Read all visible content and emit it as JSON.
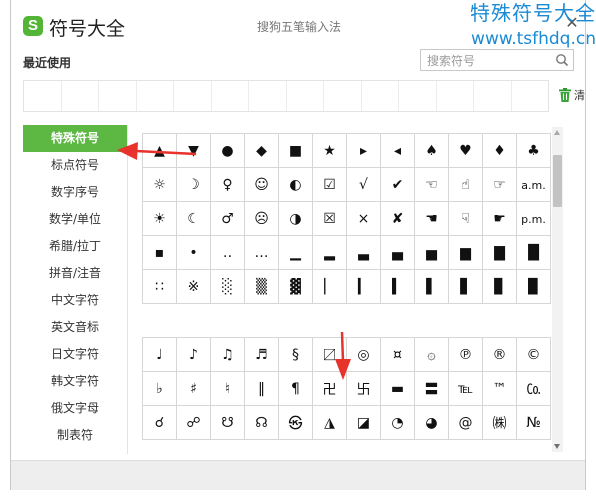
{
  "watermark": {
    "line1": "特殊符号大全",
    "line2": "www.tsfhdq.cn"
  },
  "window": {
    "app_title": "符号大全",
    "ime_name": "搜狗五笔输入法",
    "close_glyph": "✕"
  },
  "recent": {
    "label": "最近使用",
    "slots": 14
  },
  "search": {
    "placeholder": "搜索符号",
    "icon": "search-icon"
  },
  "trash": {
    "icon": "trash-icon",
    "label": "清"
  },
  "sidebar": {
    "active_index": 0,
    "items": [
      {
        "label": "特殊符号"
      },
      {
        "label": "标点符号"
      },
      {
        "label": "数字序号"
      },
      {
        "label": "数学/单位"
      },
      {
        "label": "希腊/拉丁"
      },
      {
        "label": "拼音/注音"
      },
      {
        "label": "中文字符"
      },
      {
        "label": "英文音标"
      },
      {
        "label": "日文字符"
      },
      {
        "label": "韩文字符"
      },
      {
        "label": "俄文字母"
      },
      {
        "label": "制表符"
      }
    ]
  },
  "symbols": {
    "group1": [
      [
        "▲",
        "▼",
        "●",
        "◆",
        "■",
        "★",
        "▸",
        "◂",
        "♠",
        "♥",
        "♦",
        "♣"
      ],
      [
        "☼",
        "☽",
        "♀",
        "☺",
        "◐",
        "☑",
        "√",
        "✔",
        "☜",
        "☝",
        "☞",
        "a.m."
      ],
      [
        "☀",
        "☾",
        "♂",
        "☹",
        "◑",
        "☒",
        "×",
        "✘",
        "☚",
        "☟",
        "☛",
        "p.m."
      ],
      [
        "▪",
        "•",
        "‥",
        "…",
        "▁",
        "▂",
        "▃",
        "▄",
        "▅",
        "▆",
        "▇",
        "█"
      ],
      [
        "∷",
        "※",
        "░",
        "▒",
        "▓",
        "▏",
        "▎",
        "▍",
        "▌",
        "▋",
        "▊",
        "▉"
      ]
    ],
    "group2": [
      [
        "♩",
        "♪",
        "♫",
        "♬",
        "§",
        "〼",
        "◎",
        "¤",
        "۞",
        "℗",
        "®",
        "©"
      ],
      [
        "♭",
        "♯",
        "♮",
        "‖",
        "¶",
        "卍",
        "卐",
        "▬",
        "〓",
        "℡",
        "™",
        "㏇"
      ],
      [
        "☌",
        "☍",
        "☋",
        "☊",
        "㉿",
        "◮",
        "◪",
        "◔",
        "◕",
        "@",
        "㈱",
        "№"
      ]
    ]
  },
  "colors": {
    "accent_green": "#5db743",
    "annotation_red": "#e8322c",
    "watermark_blue": "#1a8ad4"
  }
}
